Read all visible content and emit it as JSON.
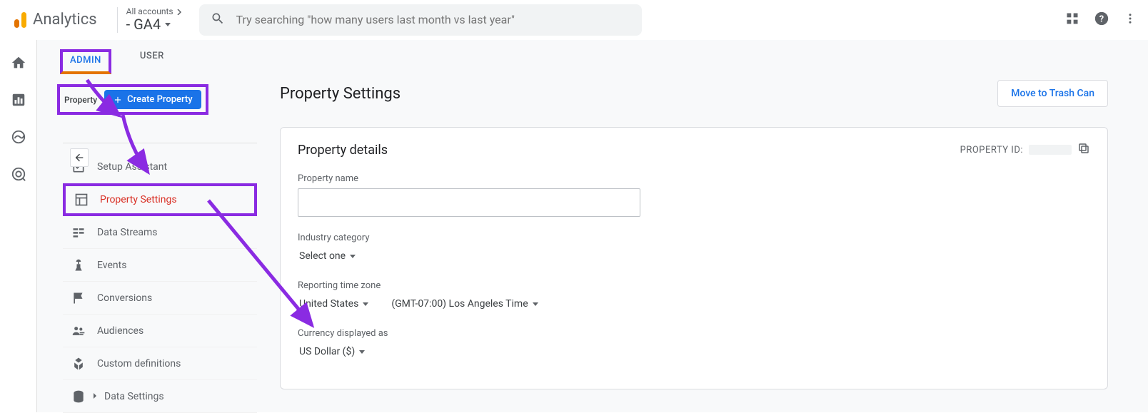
{
  "brand": "Analytics",
  "account_selector": {
    "top_line": "All accounts",
    "bottom_line": " - GA4"
  },
  "search": {
    "placeholder": "Try searching \"how many users last month vs last year\""
  },
  "tabs": {
    "admin": "ADMIN",
    "user": "USER"
  },
  "property_column": {
    "label": "Property",
    "create_btn": "Create Property",
    "items": [
      {
        "label": "Setup Assistant"
      },
      {
        "label": "Property Settings"
      },
      {
        "label": "Data Streams"
      },
      {
        "label": "Events"
      },
      {
        "label": "Conversions"
      },
      {
        "label": "Audiences"
      },
      {
        "label": "Custom definitions"
      },
      {
        "label": "Data Settings"
      }
    ]
  },
  "page": {
    "title": "Property Settings",
    "trash_btn": "Move to Trash Can"
  },
  "card": {
    "title": "Property details",
    "property_id_label": "PROPERTY ID:",
    "fields": {
      "property_name_label": "Property name",
      "industry_label": "Industry category",
      "industry_value": "Select one",
      "timezone_label": "Reporting time zone",
      "timezone_country": "United States",
      "timezone_value": "(GMT-07:00) Los Angeles Time",
      "currency_label": "Currency displayed as",
      "currency_value": "US Dollar ($)"
    }
  }
}
